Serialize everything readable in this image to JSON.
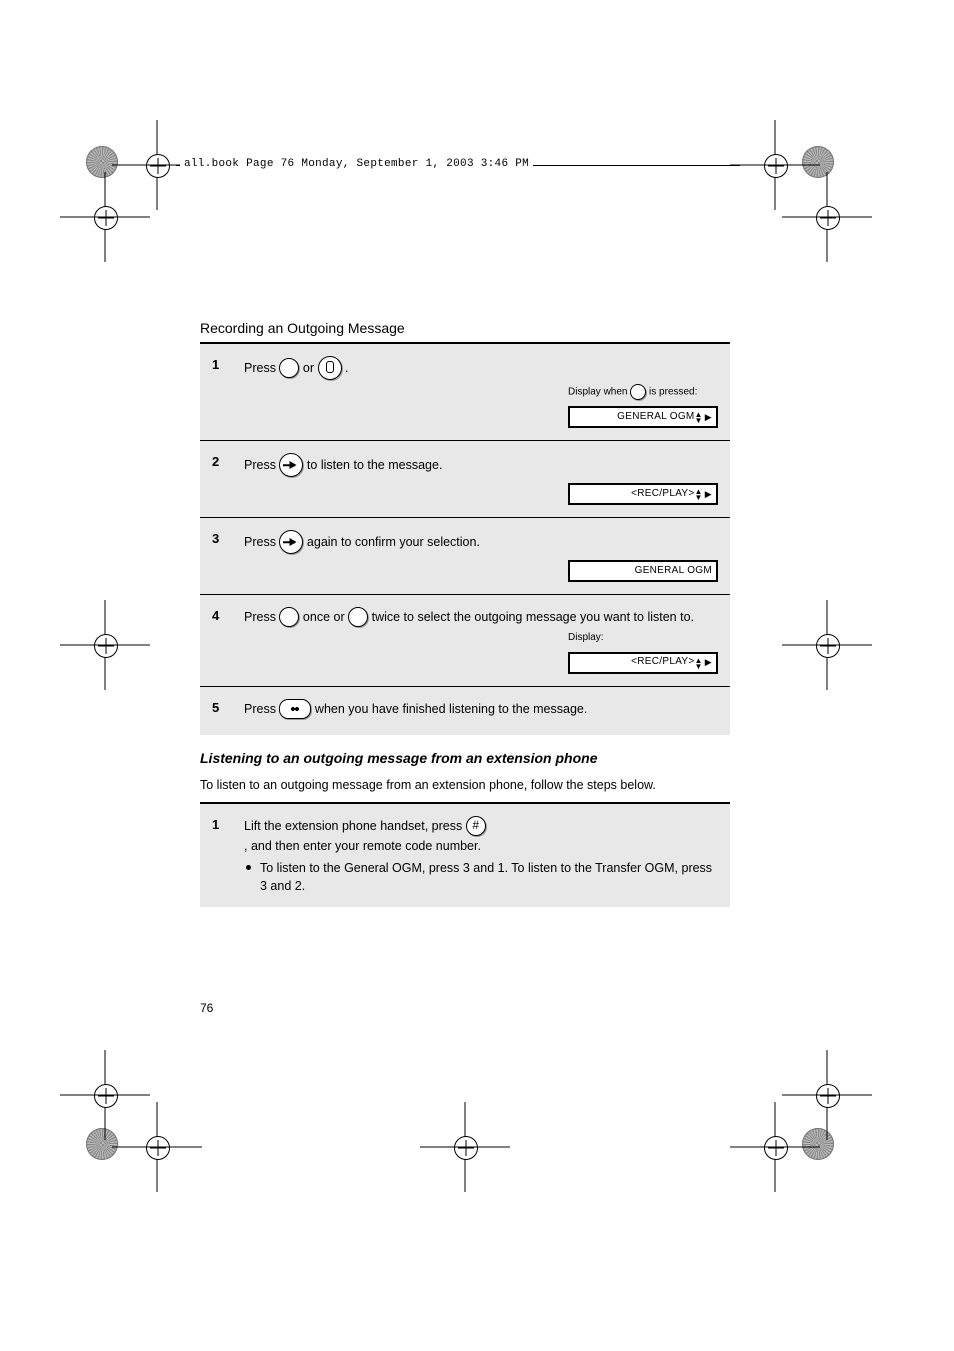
{
  "header_strip": "all.book  Page 76  Monday, September 1, 2003  3:46 PM",
  "section_title": "Recording an Outgoing Message",
  "page_number_bottom": "76",
  "steps": {
    "s1": {
      "idx": "1",
      "text_a": "Press ",
      "text_b": " or ",
      "text_c": ".",
      "display": "GENERAL OGM",
      "display_caption_a": "Display when",
      "display_caption_b": "is pressed:",
      "icon_a_name": "circle-button",
      "icon_b_name": "mic-button"
    },
    "s2": {
      "idx": "2",
      "text_a": "Press ",
      "text_b": " to listen to the message.",
      "display": "<REC/PLAY>",
      "icon_name": "play-button"
    },
    "s3": {
      "idx": "3",
      "text_a": "Press ",
      "text_b": " again to confirm your selection.",
      "display": "GENERAL OGM",
      "icon_name": "play-button"
    },
    "s4": {
      "idx": "4",
      "text_a": "Press ",
      "text_b": " once or ",
      "text_c": " twice to select the outgoing message you want to listen to.",
      "display": "<REC/PLAY>",
      "display_caption_a": "Display:",
      "icon_a_name": "circle-button",
      "icon_b_name": "circle-button"
    },
    "s5": {
      "idx": "5",
      "text_a": "Press ",
      "text_b": " when you have finished listening to the message.",
      "icon_name": "stop-button"
    }
  },
  "subsection": {
    "title": "Listening to an outgoing message from an extension phone",
    "para": "To listen to an outgoing message from an extension phone, follow the steps below.",
    "step1": {
      "idx": "1",
      "line1_a": "Lift the extension phone handset, press ",
      "line1_b": ", and then enter your remote code number.",
      "bullet": "To listen to the General OGM, press 3 and 1. To listen to the Transfer OGM, press 3 and 2.",
      "icon_name": "hash-key"
    }
  }
}
